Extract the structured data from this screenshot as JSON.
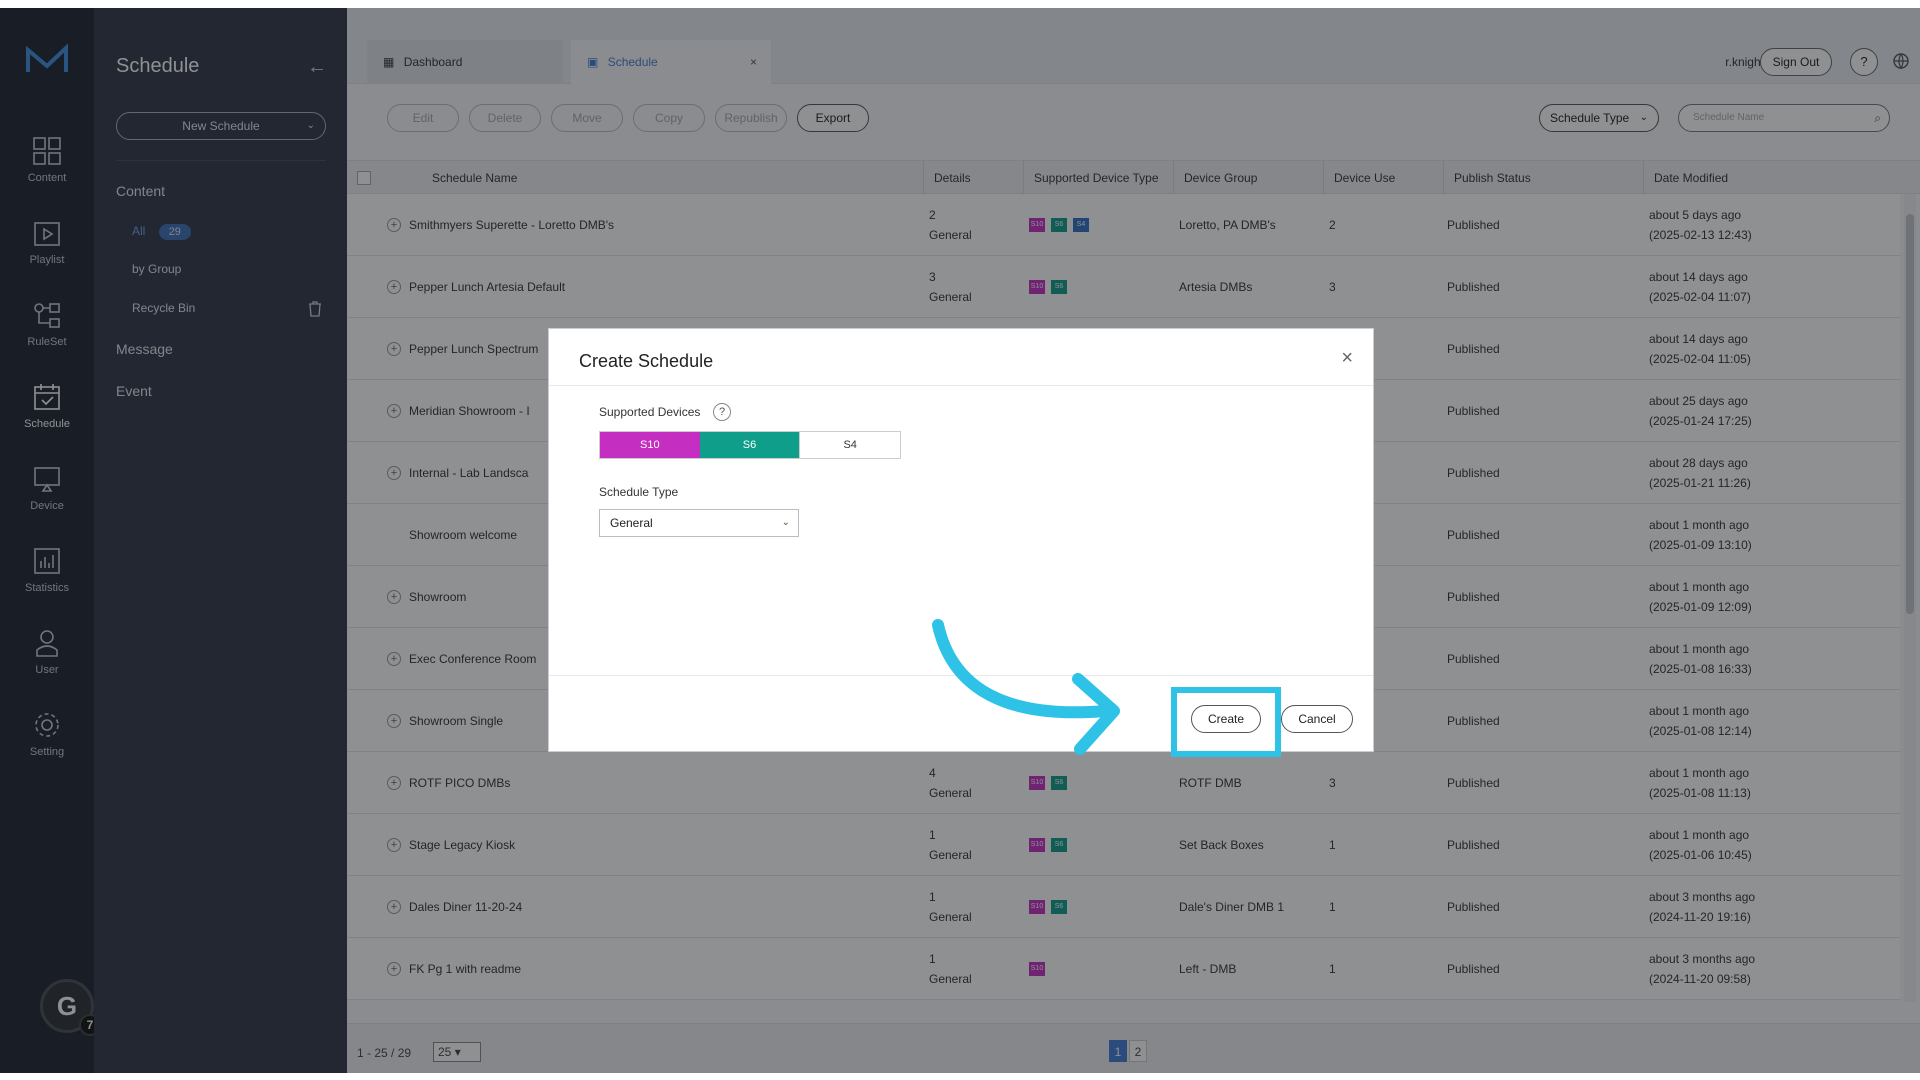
{
  "app": {
    "logo": "M-logo"
  },
  "rail": [
    {
      "label": "Content",
      "icon": "content-grid-icon"
    },
    {
      "label": "Playlist",
      "icon": "playlist-icon"
    },
    {
      "label": "RuleSet",
      "icon": "ruleset-icon"
    },
    {
      "label": "Schedule",
      "icon": "calendar-icon"
    },
    {
      "label": "Device",
      "icon": "monitor-icon"
    },
    {
      "label": "Statistics",
      "icon": "chart-icon"
    },
    {
      "label": "User",
      "icon": "user-icon"
    },
    {
      "label": "Setting",
      "icon": "gear-icon"
    }
  ],
  "grammarly": {
    "letter": "G",
    "count": "7"
  },
  "sidebar": {
    "title": "Schedule",
    "new_label": "New Schedule",
    "content_label": "Content",
    "all_label": "All",
    "all_count": "29",
    "by_group": "by Group",
    "recycle_bin": "Recycle Bin",
    "message": "Message",
    "event": "Event"
  },
  "tabs": {
    "dashboard": "Dashboard",
    "schedule": "Schedule",
    "close": "×"
  },
  "header": {
    "user": "r.knight",
    "sign_out": "Sign Out",
    "help": "?"
  },
  "toolbar": {
    "edit": "Edit",
    "delete": "Delete",
    "move": "Move",
    "copy": "Copy",
    "republish": "Republish",
    "export": "Export",
    "schedule_type": "Schedule Type",
    "search_placeholder": "Schedule Name"
  },
  "table": {
    "headers": [
      "Schedule Name",
      "Details",
      "Supported Device Type",
      "Device Group",
      "Device Use",
      "Publish Status",
      "Date Modified"
    ],
    "rows": [
      {
        "name": "Smithmyers Superette - Loretto DMB's",
        "plus": true,
        "d1": "2",
        "d2": "General",
        "chips": [
          "S10",
          "S6",
          "S4"
        ],
        "group": "Loretto, PA DMB's",
        "use": "2",
        "status": "Published",
        "m1": "about 5 days ago",
        "m2": "(2025-02-13 12:43)"
      },
      {
        "name": "Pepper Lunch Artesia Default",
        "plus": true,
        "d1": "3",
        "d2": "General",
        "chips": [
          "S10",
          "S6"
        ],
        "group": "Artesia DMBs",
        "use": "3",
        "status": "Published",
        "m1": "about 14 days ago",
        "m2": "(2025-02-04 11:07)"
      },
      {
        "name": "Pepper Lunch Spectrum",
        "plus": true,
        "d1": "",
        "d2": "",
        "chips": [],
        "group": "",
        "use": "",
        "status": "Published",
        "m1": "about 14 days ago",
        "m2": "(2025-02-04 11:05)"
      },
      {
        "name": "Meridian Showroom - I",
        "plus": true,
        "d1": "",
        "d2": "",
        "chips": [],
        "group": "",
        "use": "",
        "status": "Published",
        "m1": "about 25 days ago",
        "m2": "(2025-01-24 17:25)"
      },
      {
        "name": "Internal - Lab Landsca",
        "plus": true,
        "d1": "",
        "d2": "",
        "chips": [],
        "group": "",
        "use": "",
        "status": "Published",
        "m1": "about 28 days ago",
        "m2": "(2025-01-21 11:26)"
      },
      {
        "name": "Showroom welcome",
        "plus": false,
        "d1": "",
        "d2": "",
        "chips": [],
        "group": "",
        "use": "",
        "status": "Published",
        "m1": "about 1 month ago",
        "m2": "(2025-01-09 13:10)"
      },
      {
        "name": "Showroom",
        "plus": true,
        "d1": "",
        "d2": "",
        "chips": [],
        "group": "",
        "use": "",
        "status": "Published",
        "m1": "about 1 month ago",
        "m2": "(2025-01-09 12:09)"
      },
      {
        "name": "Exec Conference Room",
        "plus": true,
        "d1": "",
        "d2": "",
        "chips": [],
        "group": "",
        "use": "",
        "status": "Published",
        "m1": "about 1 month ago",
        "m2": "(2025-01-08 16:33)"
      },
      {
        "name": "Showroom Single",
        "plus": true,
        "d1": "",
        "d2": "",
        "chips": [],
        "group": "",
        "use": "",
        "status": "Published",
        "m1": "about 1 month ago",
        "m2": "(2025-01-08 12:14)"
      },
      {
        "name": "ROTF PICO DMBs",
        "plus": true,
        "d1": "4",
        "d2": "General",
        "chips": [
          "S10",
          "S6"
        ],
        "group": "ROTF DMB",
        "use": "3",
        "status": "Published",
        "m1": "about 1 month ago",
        "m2": "(2025-01-08 11:13)"
      },
      {
        "name": "Stage Legacy Kiosk",
        "plus": true,
        "d1": "1",
        "d2": "General",
        "chips": [
          "S10",
          "S6"
        ],
        "group": "Set Back Boxes",
        "use": "1",
        "status": "Published",
        "m1": "about 1 month ago",
        "m2": "(2025-01-06 10:45)"
      },
      {
        "name": "Dales Diner 11-20-24",
        "plus": true,
        "d1": "1",
        "d2": "General",
        "chips": [
          "S10",
          "S6"
        ],
        "group": "Dale's Diner DMB 1",
        "use": "1",
        "status": "Published",
        "m1": "about 3 months ago",
        "m2": "(2024-11-20 19:16)"
      },
      {
        "name": "FK Pg 1 with readme",
        "plus": true,
        "d1": "1",
        "d2": "General",
        "chips": [
          "S10"
        ],
        "group": "Left - DMB",
        "use": "1",
        "status": "Published",
        "m1": "about 3 months ago",
        "m2": "(2024-11-20 09:58)"
      }
    ]
  },
  "footer": {
    "range": "1 - 25 / 29",
    "page_size": "25",
    "pages": [
      "1",
      "2"
    ]
  },
  "modal": {
    "title": "Create Schedule",
    "close": "×",
    "supported_devices_label": "Supported Devices",
    "help": "?",
    "devices": [
      "S10",
      "S6",
      "S4"
    ],
    "schedule_type_label": "Schedule Type",
    "schedule_type_value": "General",
    "create": "Create",
    "cancel": "Cancel"
  },
  "colors": {
    "s10": "#c42fc1",
    "s6": "#0f9e8a",
    "s4": "#2f6fc4",
    "accent": "#3f7bd4",
    "highlight": "#2ec2e6"
  }
}
